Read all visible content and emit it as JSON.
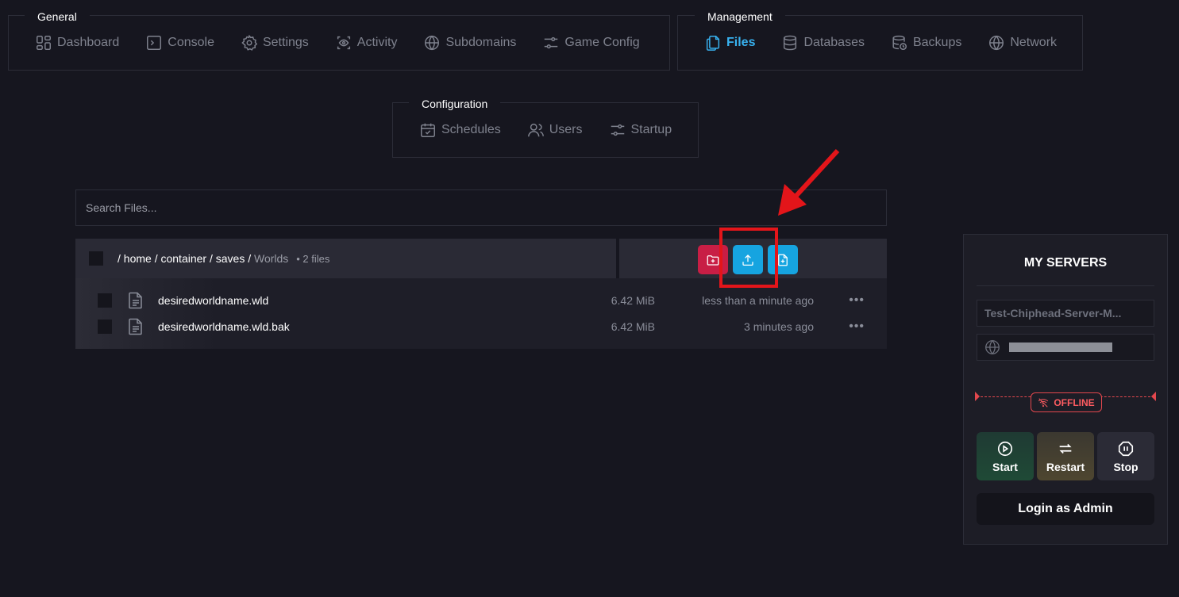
{
  "nav": {
    "general": {
      "title": "General",
      "items": [
        {
          "label": "Dashboard",
          "icon": "dashboard-icon"
        },
        {
          "label": "Console",
          "icon": "console-icon"
        },
        {
          "label": "Settings",
          "icon": "gear-icon"
        },
        {
          "label": "Activity",
          "icon": "eye-icon"
        },
        {
          "label": "Subdomains",
          "icon": "globe-icon"
        },
        {
          "label": "Game Config",
          "icon": "sliders-icon"
        }
      ]
    },
    "management": {
      "title": "Management",
      "items": [
        {
          "label": "Files",
          "icon": "files-icon",
          "active": true
        },
        {
          "label": "Databases",
          "icon": "database-icon"
        },
        {
          "label": "Backups",
          "icon": "backup-icon"
        },
        {
          "label": "Network",
          "icon": "globe-icon"
        }
      ]
    },
    "configuration": {
      "title": "Configuration",
      "items": [
        {
          "label": "Schedules",
          "icon": "calendar-icon"
        },
        {
          "label": "Users",
          "icon": "users-icon"
        },
        {
          "label": "Startup",
          "icon": "sliders-icon"
        }
      ]
    }
  },
  "search": {
    "placeholder": "Search Files..."
  },
  "file_manager": {
    "breadcrumb": {
      "sep": "/",
      "home": "home",
      "container": "container",
      "saves": "saves",
      "current": "Worlds"
    },
    "file_count": "• 2 files",
    "action_buttons": [
      {
        "name": "new-folder-button",
        "icon": "folder-plus-icon",
        "color": "#c81e45"
      },
      {
        "name": "upload-button",
        "icon": "upload-icon",
        "color": "#16a4e0"
      },
      {
        "name": "new-file-button",
        "icon": "file-plus-icon",
        "color": "#16a4e0"
      }
    ],
    "files": [
      {
        "name": "desiredworldname.wld",
        "size": "6.42 MiB",
        "modified": "less than a minute ago"
      },
      {
        "name": "desiredworldname.wld.bak",
        "size": "6.42 MiB",
        "modified": "3 minutes ago"
      }
    ],
    "menu_glyph": "•••"
  },
  "servers_panel": {
    "title": "MY SERVERS",
    "server_name": "Test-Chiphead-Server-M...",
    "status": "OFFLINE",
    "buttons": {
      "start": "Start",
      "restart": "Restart",
      "stop": "Stop"
    },
    "admin_button": "Login as Admin"
  },
  "colors": {
    "background": "#16161f",
    "accent": "#38b2f0",
    "danger": "#e2474d",
    "annotation": "#e3151a",
    "start_bg": "#1f4a36",
    "restart_bg": "#4e4630",
    "stop_bg": "#2b2b36"
  }
}
